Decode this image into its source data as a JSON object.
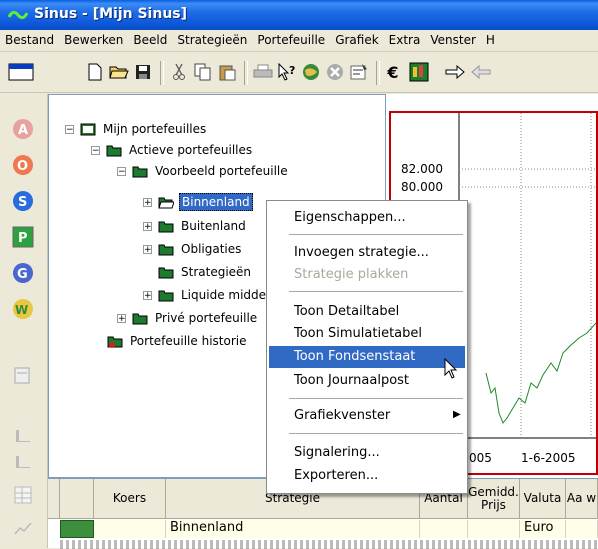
{
  "window": {
    "title": "Sinus - [Mijn Sinus]"
  },
  "menu": [
    "Bestand",
    "Bewerken",
    "Beeld",
    "Strategieën",
    "Portefeuille",
    "Grafiek",
    "Extra",
    "Venster",
    "H"
  ],
  "toolbar": [
    "display-icon",
    "new-document-icon",
    "open-folder-icon",
    "save-icon",
    "cut-icon",
    "copy-icon",
    "paste-icon",
    "print-icon",
    "help-pointer-icon",
    "globe-icon",
    "stop-icon",
    "properties-icon",
    "euro-icon",
    "chart-icon",
    "arrow-right-icon",
    "arrow-left-icon"
  ],
  "left_toolbar": [
    "strategy-a-icon",
    "strategy-o-icon",
    "strategy-s-icon",
    "strategy-p-icon",
    "strategy-g-icon",
    "strategy-w-icon",
    "properties-icon",
    "bar-chart-icon",
    "bar-chart-icon-2",
    "table-icon",
    "line-chart-icon"
  ],
  "tree": {
    "root": "Mijn portefeuilles",
    "items": [
      {
        "label": "Actieve portefeuilles",
        "expander": "−"
      },
      {
        "label": "Voorbeeld portefeuille",
        "expander": "−"
      },
      {
        "label": "Binnenland",
        "expander": "+"
      },
      {
        "label": "Buitenland",
        "expander": "+"
      },
      {
        "label": "Obligaties",
        "expander": "+"
      },
      {
        "label": "Strategieën",
        "expander": ""
      },
      {
        "label": "Liquide middelen",
        "expander": "+"
      },
      {
        "label": "Privé portefeuille",
        "expander": "+"
      },
      {
        "label": "Portefeuille historie",
        "expander": ""
      }
    ]
  },
  "chart": {
    "y_ticks": [
      "82.000",
      "80.000"
    ],
    "x_ticks": [
      "005",
      "1-6-2005"
    ]
  },
  "context_menu": [
    {
      "label": "Eigenschappen...",
      "state": "normal"
    },
    {
      "label": "Invoegen strategie...",
      "state": "normal"
    },
    {
      "label": "Strategie plakken",
      "state": "disabled"
    },
    {
      "label": "Toon Detailtabel",
      "state": "normal"
    },
    {
      "label": "Toon Simulatietabel",
      "state": "normal"
    },
    {
      "label": "Toon Fondsenstaat",
      "state": "hover"
    },
    {
      "label": "Toon Journaalpost",
      "state": "normal"
    },
    {
      "label": "Grafiekvenster",
      "state": "submenu"
    },
    {
      "label": "Signalering...",
      "state": "normal"
    },
    {
      "label": "Exporteren...",
      "state": "normal"
    }
  ],
  "table": {
    "headers": [
      "Koers",
      "Strategie",
      "Aantal",
      "Gemidd. Prijs",
      "Valuta",
      "Aa w"
    ],
    "row": {
      "strategie": "Binnenland",
      "valuta": "Euro"
    }
  },
  "colors": {
    "selection": "#316ac5",
    "chart_border": "#c00000",
    "titlebar": "#0a5fe0"
  }
}
